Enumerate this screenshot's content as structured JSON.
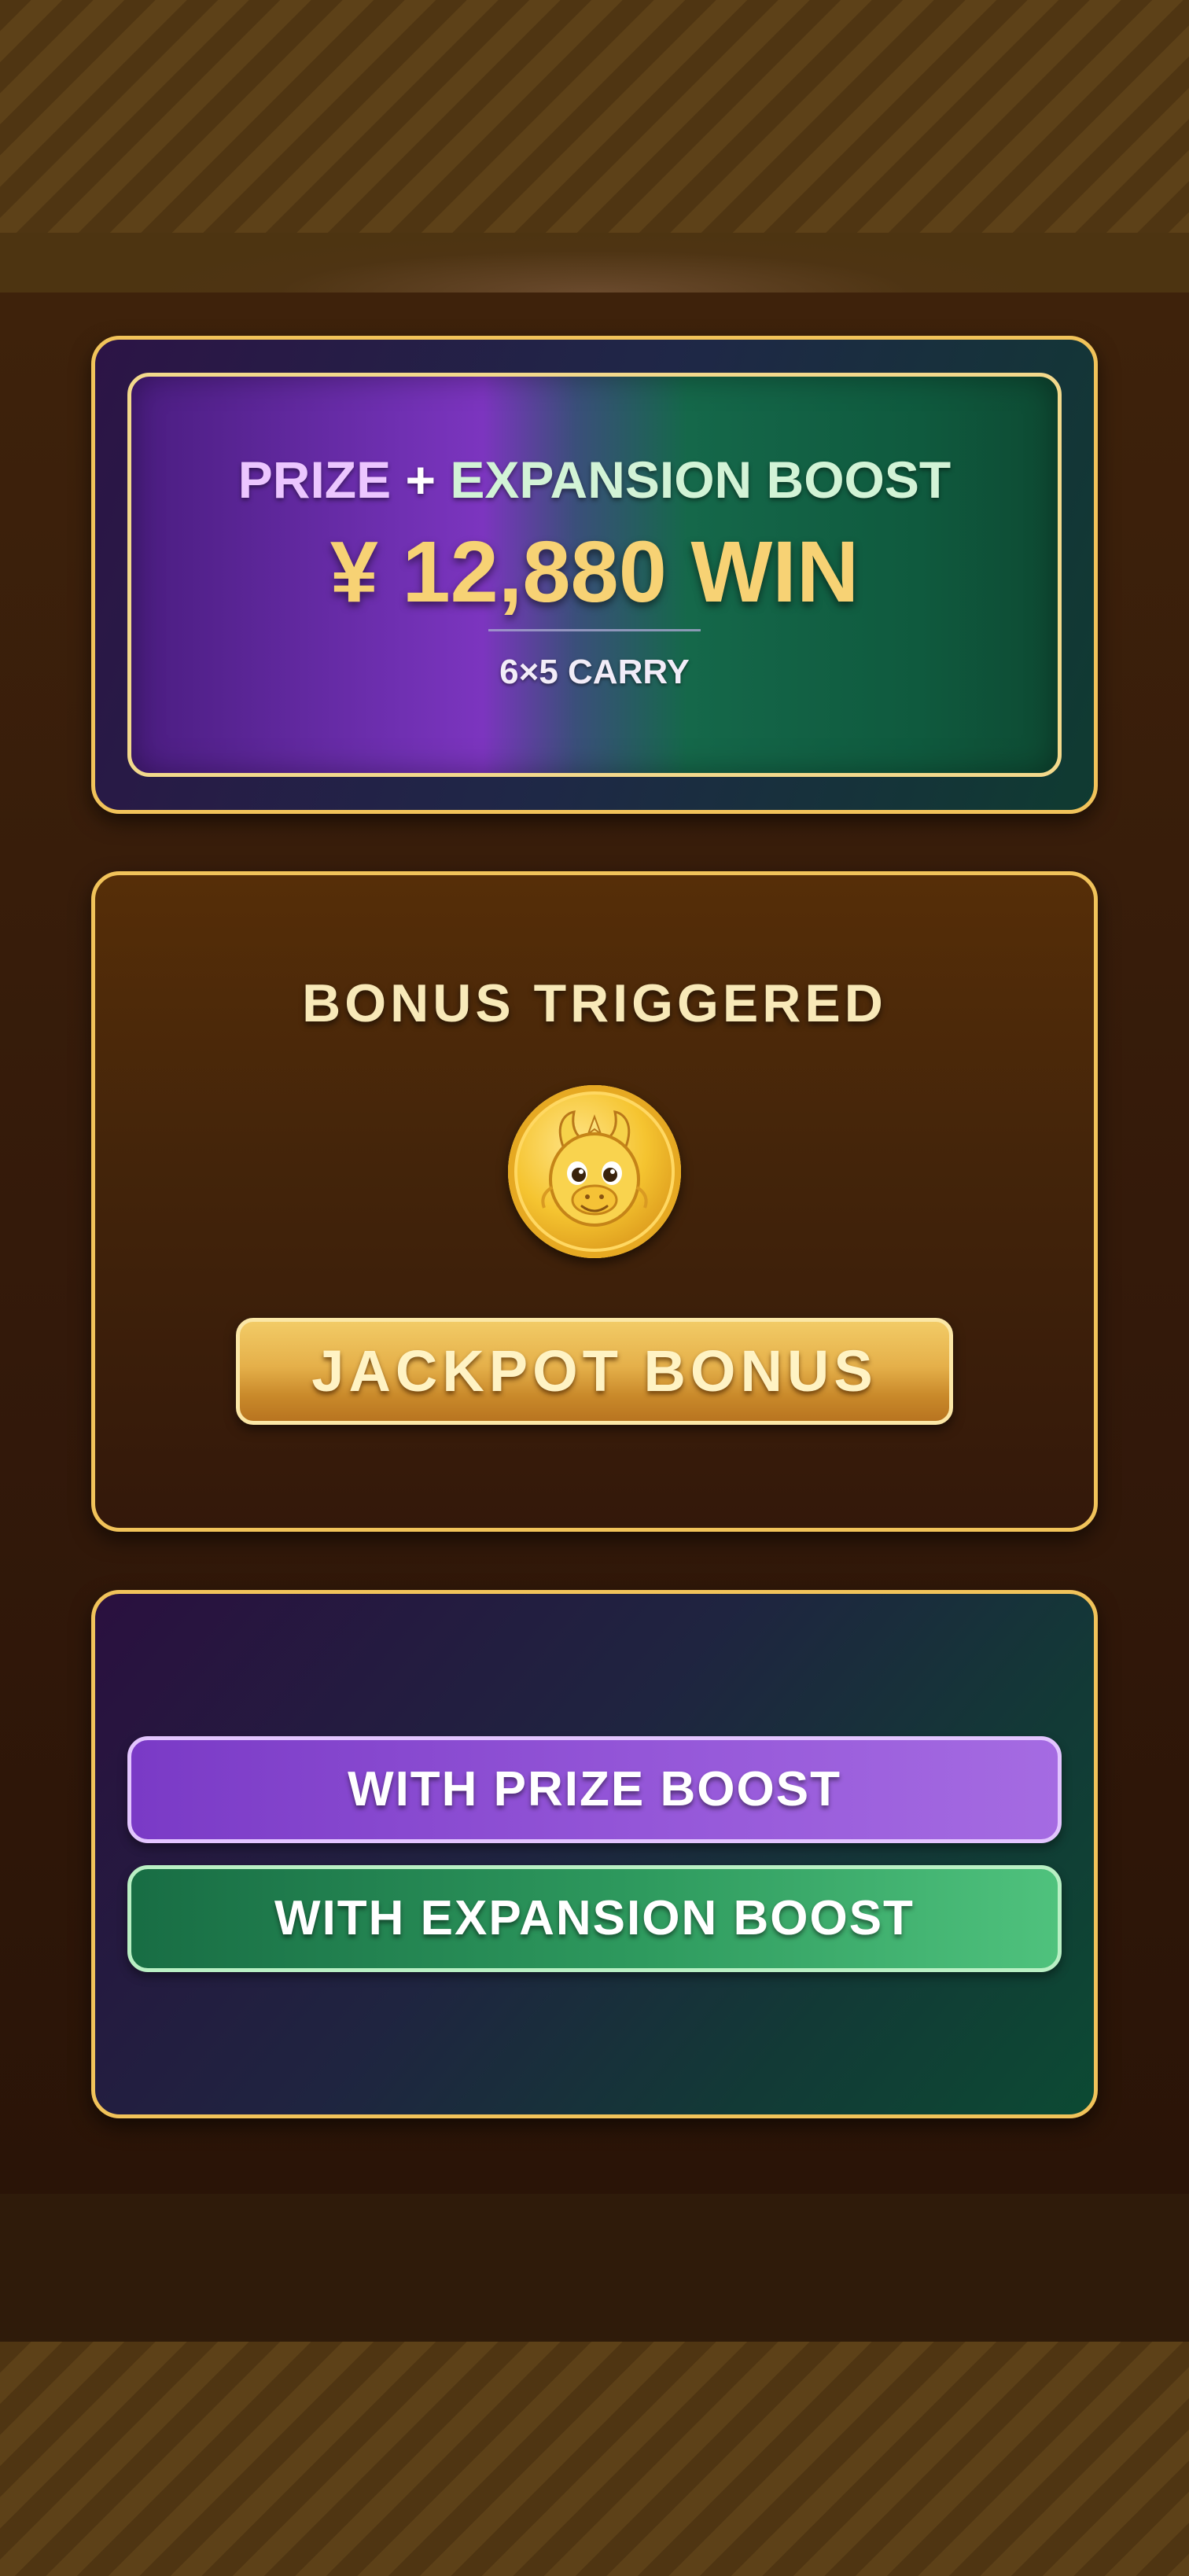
{
  "prize_card": {
    "headline_part1": "PRIZE",
    "headline_plus": "+",
    "headline_part2": "EXPANSION BOOST",
    "win_amount": "¥ 12,880 WIN",
    "carry_label": "6×5 CARRY"
  },
  "bonus_card": {
    "title": "BONUS TRIGGERED",
    "coin_icon": "dragon-coin-icon",
    "jackpot_button_label": "JACKPOT BONUS"
  },
  "boost_card": {
    "prize_boost_label": "WITH PRIZE BOOST",
    "expansion_boost_label": "WITH EXPANSION BOOST"
  },
  "colors": {
    "gold_border": "#f1c35a",
    "prize_purple": "#8a4acf",
    "expansion_green": "#2e9a5e",
    "win_gold": "#f7d274"
  }
}
